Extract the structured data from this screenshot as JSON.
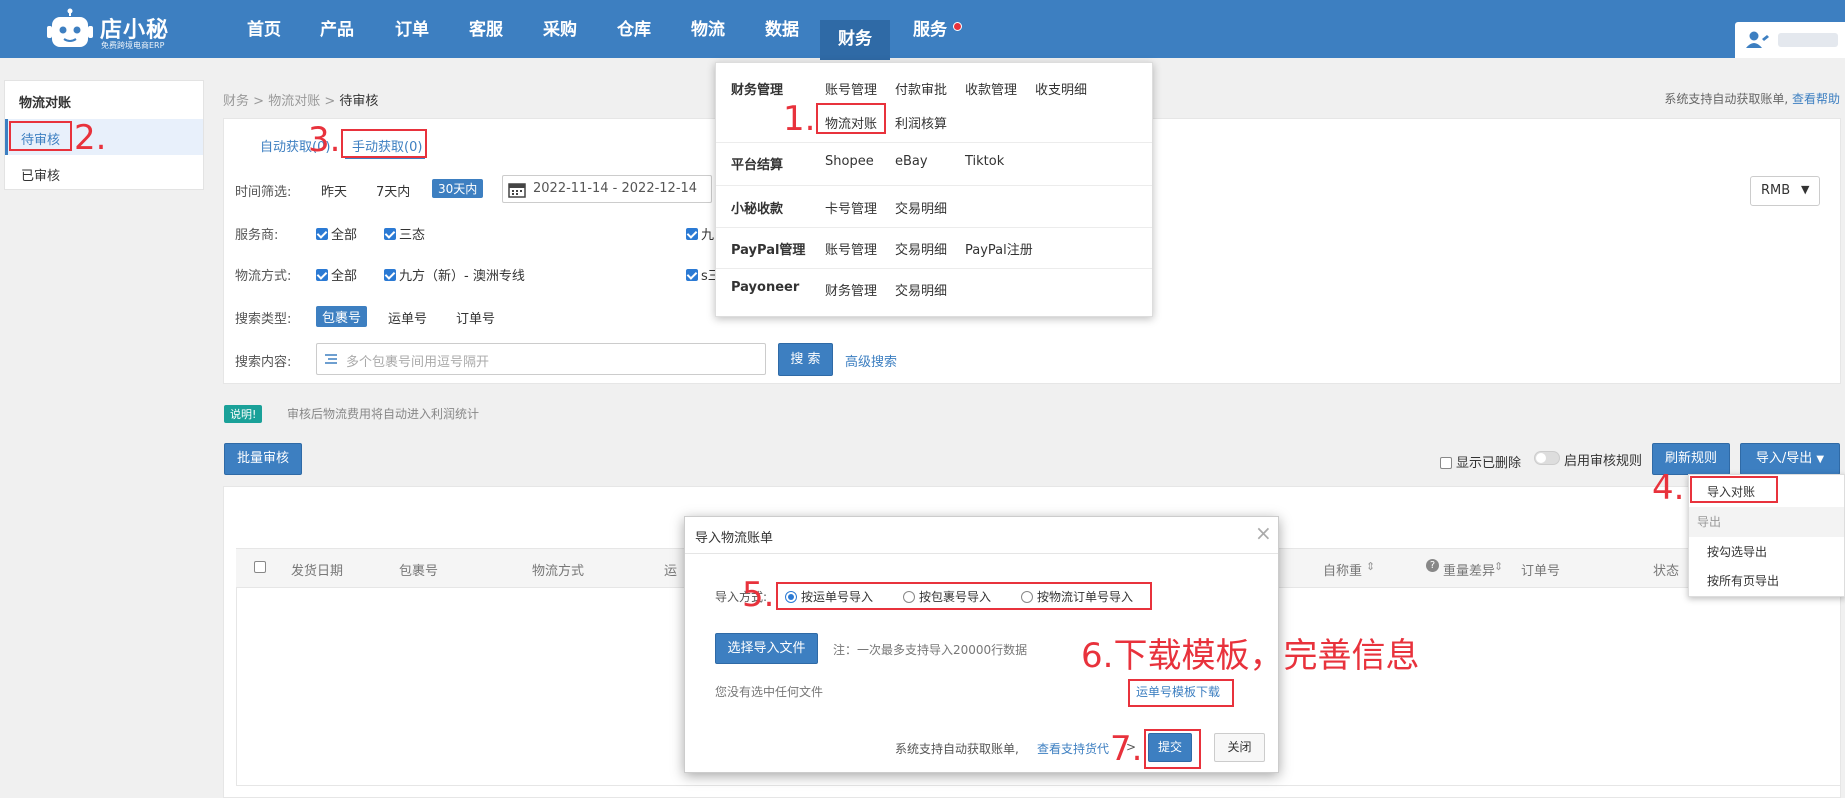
{
  "app": {
    "logo_text": "店小秘",
    "logo_sub": "免费跨境电商ERP"
  },
  "nav": {
    "items": [
      "首页",
      "产品",
      "订单",
      "客服",
      "采购",
      "仓库",
      "物流",
      "数据",
      "财务",
      "服务"
    ],
    "active": "财务"
  },
  "sidebar": {
    "title": "物流对账",
    "items": [
      "待审核",
      "已审核"
    ]
  },
  "breadcrumb": {
    "a": "财务",
    "b": "物流对账",
    "c": "待审核",
    "sep": ">"
  },
  "help": {
    "text": "系统支持自动获取账单,",
    "link": "查看帮助"
  },
  "tabs": {
    "auto": "自动获取(0)",
    "manual": "手动获取(0)"
  },
  "filters": {
    "time_label": "时间筛选:",
    "time_opts": [
      "昨天",
      "7天内",
      "30天内"
    ],
    "date_range": "2022-11-14 - 2022-12-14",
    "provider_label": "服务商:",
    "provider_all": "全部",
    "provider_1": "三态",
    "provider_2": "九",
    "method_label": "物流方式:",
    "method_all": "全部",
    "method_1": "九方（新）- 澳洲专线",
    "method_2": "s三",
    "search_type_label": "搜索类型:",
    "search_types": [
      "包裹号",
      "运单号",
      "订单号"
    ],
    "search_content_label": "搜索内容:",
    "search_placeholder": "多个包裹号间用逗号隔开",
    "search_btn": "搜 索",
    "advanced": "高级搜索",
    "currency": "RMB"
  },
  "note": {
    "badge": "说明!",
    "text": "审核后物流费用将自动进入利润统计"
  },
  "toolbar": {
    "batch": "批量审核",
    "show_deleted": "显示已删除",
    "enable_rule": "启用审核规则",
    "refresh_rule": "刷新规则",
    "import_export": "导入/导出"
  },
  "table": {
    "headers": [
      "发货日期",
      "包裹号",
      "物流方式",
      "运",
      "自称重",
      "重量差异",
      "订单号",
      "状态"
    ]
  },
  "finance_menu": {
    "groups": [
      {
        "title": "财务管理",
        "items": [
          "账号管理",
          "付款审批",
          "收款管理",
          "收支明细",
          "物流对账",
          "利润核算"
        ]
      },
      {
        "title": "平台结算",
        "items": [
          "Shopee",
          "eBay",
          "Tiktok"
        ]
      },
      {
        "title": "小秘收款",
        "items": [
          "卡号管理",
          "交易明细"
        ]
      },
      {
        "title": "PayPal管理",
        "items": [
          "账号管理",
          "交易明细",
          "PayPal注册"
        ]
      },
      {
        "title": "Payoneer",
        "items": [
          "财务管理",
          "交易明细"
        ]
      }
    ]
  },
  "ie_menu": {
    "import": "导入对账",
    "export_header": "导出",
    "export_checked": "按勾选导出",
    "export_all": "按所有页导出"
  },
  "modal": {
    "title": "导入物流账单",
    "close": "×",
    "method_label": "导入方式:",
    "options": [
      "按运单号导入",
      "按包裹号导入",
      "按物流订单号导入"
    ],
    "select_file": "选择导入文件",
    "file_note": "注：一次最多支持导入20000行数据",
    "no_file": "您没有选中任何文件",
    "template_link": "运单号模板下载",
    "footer_text": "系统支持自动获取账单,",
    "footer_link": "查看支持货代",
    "footer_arrow": ">",
    "submit": "提交",
    "cancel": "关闭"
  },
  "annotations": {
    "n1": "1.",
    "n2": "2.",
    "n3": "3.",
    "n4": "4.",
    "n5": "5.",
    "n6": "6.下载模板，完善信息",
    "n7": "7."
  },
  "colors": {
    "brand": "#3d7fc1",
    "annotation": "#e8323c",
    "note_badge": "#1aa199"
  }
}
